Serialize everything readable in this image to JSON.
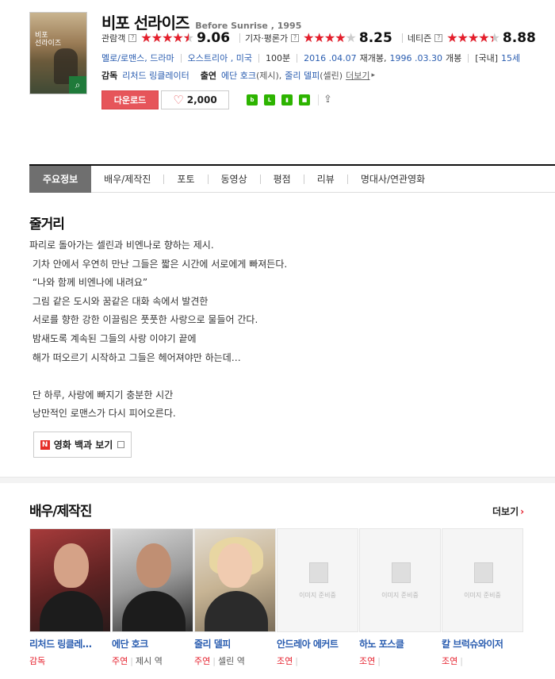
{
  "movie": {
    "poster_title": "비포\n선라이즈",
    "title": "비포 선라이즈",
    "subtitle": "Before Sunrise , 1995",
    "ratings": [
      {
        "label": "관람객",
        "score": "9.06",
        "stars_fraction": 0.906
      },
      {
        "label": "기자·평론가",
        "score": "8.25",
        "stars_fraction": 0.825
      },
      {
        "label": "네티즌",
        "score": "8.88",
        "stars_fraction": 0.888
      }
    ],
    "help_glyph": "?",
    "stars_glyph": "★★★★★",
    "info": {
      "genres": "멜로/로맨스, 드라마",
      "countries": "오스트리아 , 미국",
      "runtime": "100분",
      "release1": "2016 .04.07",
      "release1_note": "재개봉,",
      "release2": "1996 .03.30",
      "release2_note": "개봉",
      "grade": "[국내]",
      "grade_value": "15세"
    },
    "credits": {
      "director_label": "감독",
      "director": "리처드 링클레이터",
      "cast_label": "출연",
      "cast1": "에단 호크",
      "cast1_role": "(제시),",
      "cast2": "줄리 델피",
      "cast2_role": "(셀린)",
      "more": "더보기"
    },
    "buttons": {
      "download": "다운로드",
      "like_count": "2,000"
    },
    "share_icons": [
      "blog-icon",
      "line-icon",
      "bookmark-icon",
      "me-icon",
      "share-icon"
    ]
  },
  "tabs": [
    "주요정보",
    "배우/제작진",
    "포토",
    "동영상",
    "평점",
    "리뷰",
    "명대사/연관영화"
  ],
  "synopsis": {
    "title": "줄거리",
    "text": "파리로 돌아가는 셀린과 비엔나로 향하는 제시.\n 기차 안에서 우연히 만난 그들은 짧은 시간에 서로에게 빠져든다.\n “나와 함께 비엔나에 내려요”\n 그림 같은 도시와 꿈같은 대화 속에서 발견한\n 서로를 향한 강한 이끌림은 풋풋한 사랑으로 물들어 간다.\n 밤새도록 계속된 그들의 사랑 이야기 끝에\n 해가 떠오르기 시작하고 그들은 헤어져야만 하는데…\n\n 단 하루, 사랑에 빠지기 충분한 시간\n 낭만적인 로맨스가 다시 피어오른다.",
    "encyclopedia_badge": "N",
    "encyclopedia_button": "영화 백과 보기"
  },
  "cast_section": {
    "title": "배우/제작진",
    "more": "더보기",
    "more_chevron": "›",
    "placeholder_text": "이미지 준비중",
    "people": [
      {
        "name": "리처드 링클레…",
        "role_type": "감독",
        "character": ""
      },
      {
        "name": "에단 호크",
        "role_type": "주연",
        "character": "제시 역"
      },
      {
        "name": "줄리 델피",
        "role_type": "주연",
        "character": "셀린 역"
      },
      {
        "name": "안드레아 에커트",
        "role_type": "조연",
        "character": ""
      },
      {
        "name": "하노 포스클",
        "role_type": "조연",
        "character": ""
      },
      {
        "name": "칼 브럭슈와이저",
        "role_type": "조연",
        "character": ""
      }
    ]
  }
}
